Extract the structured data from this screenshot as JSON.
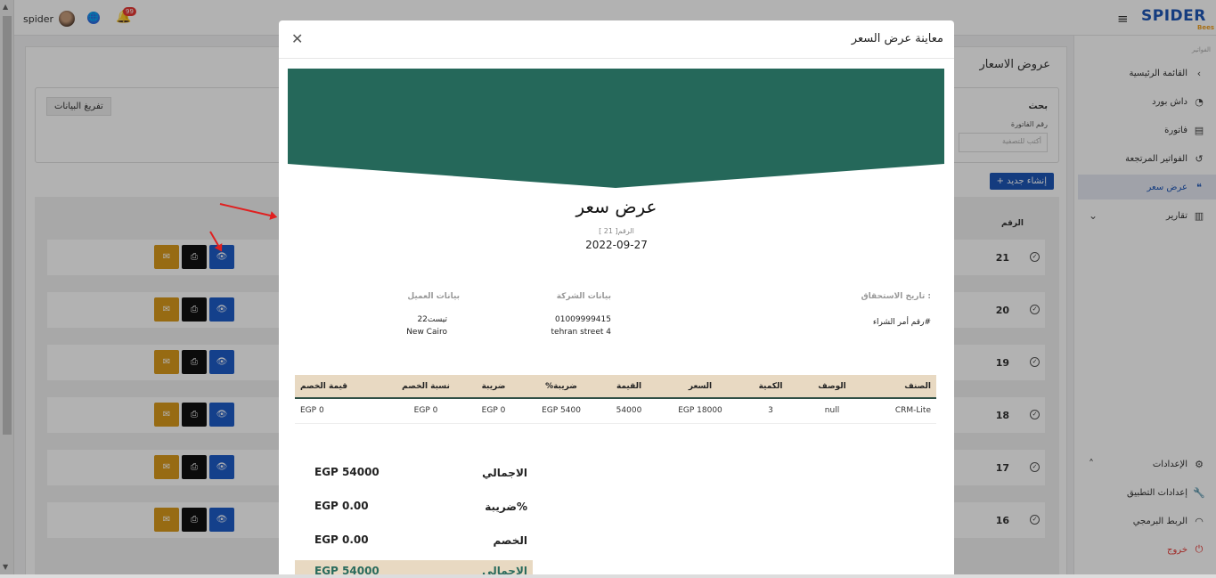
{
  "app": {
    "brand": "SPIDER",
    "brand_sub": "Bees",
    "user_name": "spider",
    "notification_count": "99"
  },
  "sidebar": {
    "crumb": "الفواتير",
    "items": [
      {
        "label": "القائمة الرئيسية",
        "icon": "chevron-left-icon"
      },
      {
        "label": "داش بورد",
        "icon": "dashboard-icon"
      },
      {
        "label": "فاتورة",
        "icon": "invoice-icon"
      },
      {
        "label": "الفواتير المرتجعة",
        "icon": "return-icon"
      },
      {
        "label": "عرض سعر",
        "icon": "quote-icon"
      },
      {
        "label": "تقارير",
        "icon": "chart-icon"
      },
      {
        "label": "الإعدادات",
        "icon": "gear-icon"
      },
      {
        "label": "إعدادات التطبيق",
        "icon": "wrench-icon"
      },
      {
        "label": "الربط البرمجي",
        "icon": "wifi-icon"
      },
      {
        "label": "خروج",
        "icon": "power-icon"
      }
    ]
  },
  "page": {
    "title": "عروض الاسعار",
    "clear_button": "تفريغ البيانات",
    "search_title": "بحث",
    "search_label": "رقم الفاتورة",
    "search_placeholder": "أكتب للتصفية",
    "new_button": "+ إنشاء جديد",
    "column_number": "الرقم",
    "rows": [
      "21",
      "20",
      "19",
      "18",
      "17",
      "16"
    ]
  },
  "modal": {
    "title": "معاينة عرض السعر",
    "doc_title": "عرض سعر",
    "doc_number": "الرقم[ 21 ]",
    "doc_date": "2022-09-27",
    "due_date_label": "تاريخ الاستحقاق :",
    "po_label": "رقم أمر الشراء#",
    "company_head": "بيانات الشركة",
    "company_phone": "01009999415",
    "company_address": "tehran street 4",
    "client_head": "بيانات العميل",
    "client_name": "تيست22",
    "client_city": "New Cairo",
    "banner_color": "#25685a",
    "table": {
      "headers": [
        "الصنف",
        "الوصف",
        "الكمية",
        "السعر",
        "القيمة",
        "ضريبة%",
        "ضريبة",
        "نسبة الخصم",
        "قيمة الخصم"
      ],
      "rows": [
        [
          "CRM-Lite",
          "null",
          "3",
          "EGP 18000",
          "54000",
          "EGP 5400",
          "EGP 0",
          "EGP 0",
          "EGP 0"
        ]
      ]
    },
    "totals": {
      "total_label": "الاجمالي",
      "total_value": "EGP 54000",
      "tax_label": "ضريبة%",
      "tax_value": "EGP 0.00",
      "discount_label": "الخصم",
      "discount_value": "EGP 0.00",
      "grand_label": "الاجمالي",
      "grand_value": "EGP 54000"
    }
  }
}
